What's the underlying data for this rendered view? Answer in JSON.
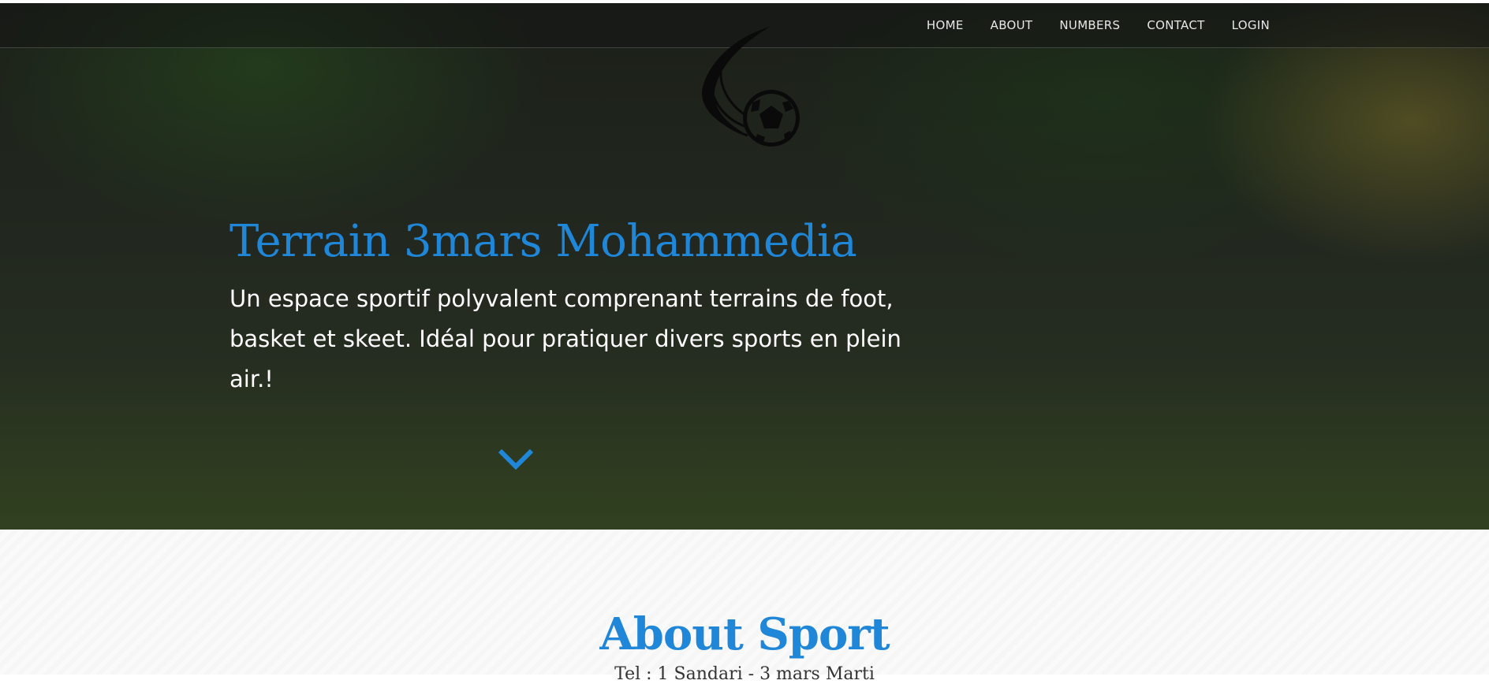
{
  "nav": {
    "items": [
      {
        "label": "HOME"
      },
      {
        "label": "ABOUT"
      },
      {
        "label": "NUMBERS"
      },
      {
        "label": "CONTACT"
      },
      {
        "label": "LOGIN"
      }
    ]
  },
  "hero": {
    "title": "Terrain 3mars Mohammedia",
    "subtitle": "Un espace sportif polyvalent comprenant terrains de foot, basket et skeet. Idéal pour pratiquer divers sports en plein air.!",
    "logo_icon": "soccer-ball-logo-icon",
    "scroll_icon": "chevron-down-icon"
  },
  "about": {
    "title": "About Sport",
    "subtitle": "Tel : 1 Sandari - 3 mars Marti"
  },
  "colors": {
    "accent": "#1f86d8",
    "nav_text": "#e8e8e8",
    "hero_overlay": "#1b1f19"
  }
}
